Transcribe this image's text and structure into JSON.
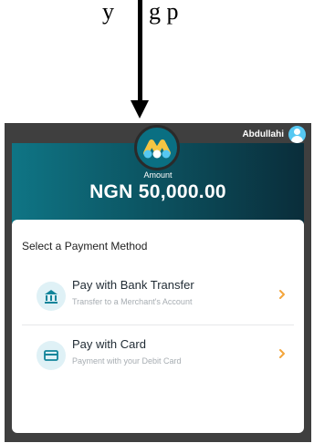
{
  "caption": {
    "left_text": "y",
    "right_text": "g       p"
  },
  "user": {
    "name": "Abdullahi"
  },
  "amount": {
    "label": "Amount",
    "value": "NGN 50,000.00"
  },
  "payment": {
    "title": "Select a Payment Method",
    "methods": [
      {
        "title": "Pay with Bank Transfer",
        "subtitle": "Transfer to a Merchant's Account",
        "icon": "bank-icon"
      },
      {
        "title": "Pay with Card",
        "subtitle": "Payment with your Debit Card",
        "icon": "card-icon"
      }
    ]
  },
  "colors": {
    "frame": "#3f3f3f",
    "header_start": "#0f7585",
    "header_end": "#0a2d3a",
    "accent_yellow": "#f4c542",
    "icon_teal": "#10849a",
    "chevron_orange": "#f3a53b"
  }
}
